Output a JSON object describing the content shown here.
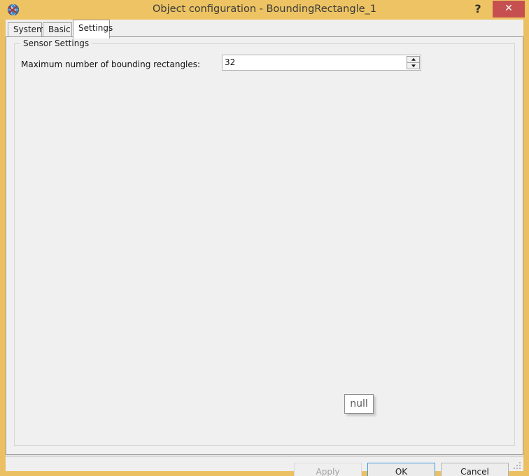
{
  "window": {
    "title": "Object configuration - BoundingRectangle_1",
    "icon": "app-globe-icon",
    "help_label": "?",
    "close_label": "✕",
    "titlebar_color": "#edc363",
    "close_color": "#c6504f"
  },
  "tabs": [
    {
      "label": "System",
      "active": false
    },
    {
      "label": "Basic",
      "active": false
    },
    {
      "label": "Settings",
      "active": true
    }
  ],
  "groupbox": {
    "title": "Sensor Settings"
  },
  "fields": {
    "max_rectangles": {
      "label": "Maximum number of bounding rectangles:",
      "value": "32",
      "placeholder": "",
      "spinner_up": "▲",
      "spinner_down": "▼"
    }
  },
  "tooltip": {
    "text": "null"
  },
  "buttons": {
    "apply": {
      "label": "Apply",
      "enabled": false
    },
    "ok": {
      "label": "OK",
      "enabled": true,
      "focus_color": "#3d9ae0"
    },
    "cancel": {
      "label": "Cancel",
      "enabled": true
    }
  },
  "statusbar": {
    "grip": "resize-grip"
  }
}
